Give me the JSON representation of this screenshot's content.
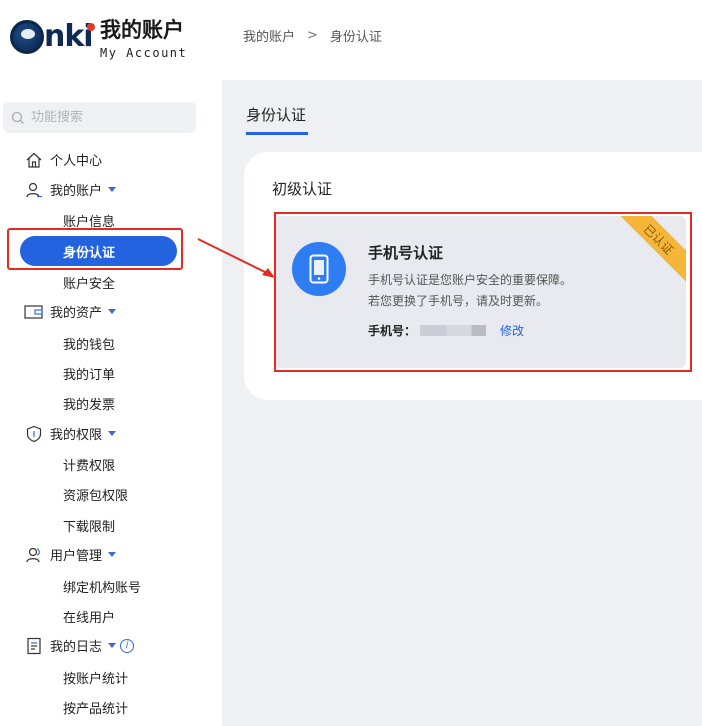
{
  "header": {
    "logo_cn": "我的账户",
    "logo_en": "My Account",
    "breadcrumb": [
      "我的账户",
      "身份认证"
    ],
    "breadcrumb_sep": ">"
  },
  "sidebar": {
    "search_placeholder": "功能搜索",
    "groups": [
      {
        "label": "个人中心",
        "icon": "home-icon"
      },
      {
        "label": "我的账户",
        "icon": "user-icon",
        "items": [
          "账户信息",
          "身份认证",
          "账户安全"
        ]
      },
      {
        "label": "我的资产",
        "icon": "wallet-icon",
        "items": [
          "我的钱包",
          "我的订单",
          "我的发票"
        ]
      },
      {
        "label": "我的权限",
        "icon": "shield-icon",
        "items": [
          "计费权限",
          "资源包权限",
          "下载限制"
        ]
      },
      {
        "label": "用户管理",
        "icon": "users-icon",
        "items": [
          "绑定机构账号",
          "在线用户"
        ]
      },
      {
        "label": "我的日志",
        "icon": "log-icon",
        "items": [
          "按账户统计",
          "按产品统计"
        ]
      }
    ],
    "active_item": "身份认证"
  },
  "main": {
    "tab": "身份认证",
    "card_title": "初级认证",
    "auth": {
      "title": "手机号认证",
      "desc_line1": "手机号认证是您账户安全的重要保障。",
      "desc_line2": "若您更换了手机号，请及时更新。",
      "phone_label": "手机号：",
      "modify_label": "修改",
      "status_ribbon": "已认证"
    }
  },
  "colors": {
    "accent": "#2463e0",
    "annotation_red": "#e32b23",
    "ribbon": "#f6b63a"
  }
}
